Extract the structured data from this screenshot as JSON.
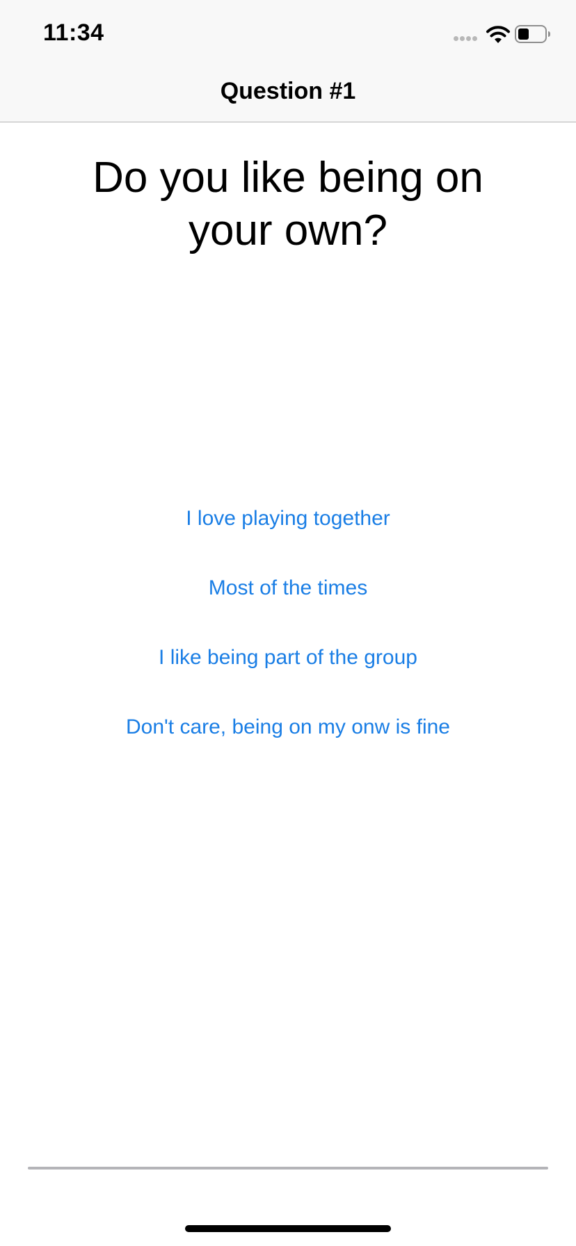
{
  "status_bar": {
    "time": "11:34",
    "icons": [
      "signal-icon",
      "wifi-icon",
      "battery-icon"
    ]
  },
  "nav": {
    "title": "Question #1"
  },
  "question": {
    "text": "Do you like being on your own?"
  },
  "answers": [
    "I love playing together",
    "Most of the times",
    "I like being part of the group",
    "Don't care, being on my onw is fine"
  ],
  "progress": {
    "value": 0
  },
  "colors": {
    "accent": "#1a7ee5",
    "bar_background": "#f8f8f8",
    "track": "#b4b4b8"
  }
}
